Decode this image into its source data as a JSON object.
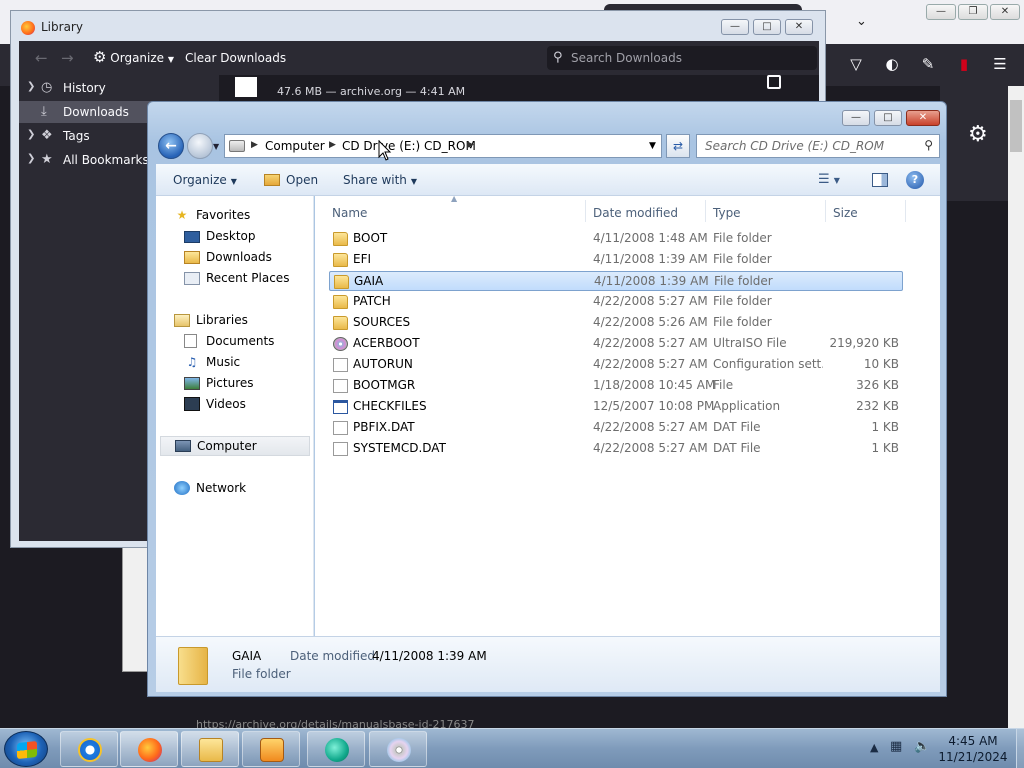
{
  "library": {
    "title": "Library",
    "organize_label": "Organize",
    "clear_downloads_label": "Clear Downloads",
    "search_placeholder": "Search Downloads",
    "sidebar": [
      {
        "label": "History",
        "icon": "clock-icon",
        "selected": false
      },
      {
        "label": "Downloads",
        "icon": "download-icon",
        "selected": true
      },
      {
        "label": "Tags",
        "icon": "tag-icon",
        "selected": false
      },
      {
        "label": "All Bookmarks",
        "icon": "star-icon",
        "selected": false
      }
    ],
    "download": {
      "meta": "47.6 MB — archive.org — 4:41 AM"
    }
  },
  "firefox_bg": {
    "status_url": "https://archive.org/details/manualsbase-id-217637"
  },
  "explorer": {
    "breadcrumb": [
      "Computer",
      "CD Drive (E:) CD_ROM"
    ],
    "search_placeholder": "Search CD Drive (E:) CD_ROM",
    "commands": {
      "organize": "Organize",
      "open": "Open",
      "share": "Share with"
    },
    "nav": {
      "favorites": "Favorites",
      "fav_items": [
        "Desktop",
        "Downloads",
        "Recent Places"
      ],
      "libraries": "Libraries",
      "lib_items": [
        "Documents",
        "Music",
        "Pictures",
        "Videos"
      ],
      "computer": "Computer",
      "network": "Network"
    },
    "columns": {
      "name": "Name",
      "date": "Date modified",
      "type": "Type",
      "size": "Size"
    },
    "files": [
      {
        "name": "BOOT",
        "date": "4/11/2008 1:48 AM",
        "type": "File folder",
        "size": "",
        "icon": "folder"
      },
      {
        "name": "EFI",
        "date": "4/11/2008 1:39 AM",
        "type": "File folder",
        "size": "",
        "icon": "folder"
      },
      {
        "name": "GAIA",
        "date": "4/11/2008 1:39 AM",
        "type": "File folder",
        "size": "",
        "icon": "folder"
      },
      {
        "name": "PATCH",
        "date": "4/22/2008 5:27 AM",
        "type": "File folder",
        "size": "",
        "icon": "folder"
      },
      {
        "name": "SOURCES",
        "date": "4/22/2008 5:26 AM",
        "type": "File folder",
        "size": "",
        "icon": "folder"
      },
      {
        "name": "ACERBOOT",
        "date": "4/22/2008 5:27 AM",
        "type": "UltraISO File",
        "size": "219,920 KB",
        "icon": "disc"
      },
      {
        "name": "AUTORUN",
        "date": "4/22/2008 5:27 AM",
        "type": "Configuration sett...",
        "size": "10 KB",
        "icon": "config"
      },
      {
        "name": "BOOTMGR",
        "date": "1/18/2008 10:45 AM",
        "type": "File",
        "size": "326 KB",
        "icon": "file"
      },
      {
        "name": "CHECKFILES",
        "date": "12/5/2007 10:08 PM",
        "type": "Application",
        "size": "232 KB",
        "icon": "app"
      },
      {
        "name": "PBFIX.DAT",
        "date": "4/22/2008 5:27 AM",
        "type": "DAT File",
        "size": "1 KB",
        "icon": "file"
      },
      {
        "name": "SYSTEMCD.DAT",
        "date": "4/22/2008 5:27 AM",
        "type": "DAT File",
        "size": "1 KB",
        "icon": "file"
      }
    ],
    "selected_index": 2,
    "details": {
      "name": "GAIA",
      "type": "File folder",
      "modified_label": "Date modified:",
      "modified_value": "4/11/2008 1:39 AM"
    }
  },
  "taskbar": {
    "apps": [
      "internet-explorer",
      "firefox",
      "windows-explorer",
      "media-player",
      "capture-app",
      "cd-burner"
    ],
    "clock_time": "4:45 AM",
    "clock_date": "11/21/2024"
  }
}
